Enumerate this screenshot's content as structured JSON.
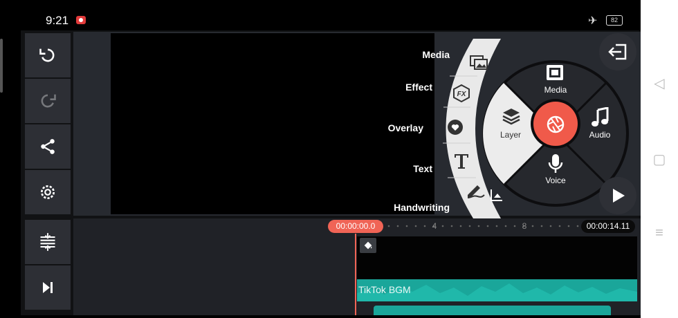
{
  "status_bar": {
    "time": "9:21",
    "battery": "82"
  },
  "toolbar": [
    {
      "icon": "undo-icon",
      "enabled": true
    },
    {
      "icon": "redo-icon",
      "enabled": false
    },
    {
      "icon": "share-icon",
      "enabled": true
    },
    {
      "icon": "settings-icon",
      "enabled": true
    }
  ],
  "timeline_tools": [
    {
      "icon": "track-adjust-icon"
    },
    {
      "icon": "skip-to-end-icon"
    }
  ],
  "media_fan": {
    "items": [
      {
        "label": "Media",
        "icon": "image-stack-icon"
      },
      {
        "label": "Effect",
        "icon": "fx-icon"
      },
      {
        "label": "Overlay",
        "icon": "sticker-icon"
      },
      {
        "label": "Text",
        "icon": "text-icon"
      },
      {
        "label": "Handwriting",
        "icon": "pen-icon"
      }
    ]
  },
  "circle_menu": {
    "media_label": "Media",
    "audio_label": "Audio",
    "voice_label": "Voice",
    "layer_label": "Layer",
    "accent_color": "#f05a4a"
  },
  "timeline": {
    "current_time": "00:00:00.0",
    "total_time": "00:00:14.11",
    "ruler_marks": [
      "4",
      "8"
    ],
    "audio_track_label": "TikTok BGM",
    "track_color": "#1aa69a",
    "playhead_color": "#f06456"
  }
}
